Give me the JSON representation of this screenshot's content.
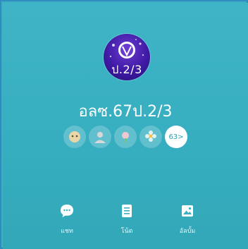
{
  "profile": {
    "avatar_label": "ป.2/3",
    "group_name": "อลซ.67ป.2/3",
    "members_more": "63>"
  },
  "actions": [
    {
      "label": "แชท",
      "icon": "chat-bubble-icon"
    },
    {
      "label": "โน้ต",
      "icon": "note-icon"
    },
    {
      "label": "อัลบั้ม",
      "icon": "album-icon"
    }
  ],
  "colors": {
    "background": "#3bb0c3",
    "avatar": "#3f1aa4",
    "frame": "#2f8bc0"
  }
}
